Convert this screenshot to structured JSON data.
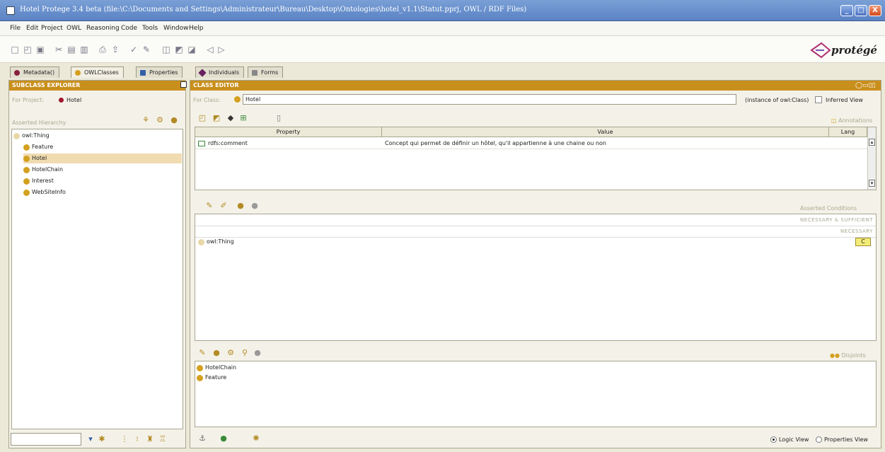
{
  "window": {
    "title": "Hotel Protege 3.4 beta   (file:\\C:\\Documents and Settings\\Administrateur\\Bureau\\Desktop\\Ontologies\\hotel_v1.1\\Statut.pprj, OWL / RDF Files)",
    "buttons": {
      "minimize": "_",
      "maximize": "□",
      "close": "X"
    }
  },
  "menu": [
    "File",
    "Edit",
    "Project",
    "OWL",
    "Reasoning",
    "Code",
    "Tools",
    "Window",
    "Help"
  ],
  "logo": {
    "text": "protégé"
  },
  "tabs": [
    {
      "label": "Metadata()",
      "color": "#8a2040"
    },
    {
      "label": "OWLClasses",
      "color": "#d4a020"
    },
    {
      "label": "Properties",
      "color": "#3560a8"
    },
    {
      "label": "Individuals",
      "color": "#6a2060"
    },
    {
      "label": "Forms",
      "color": "#888888"
    }
  ],
  "left": {
    "header": "SUBCLASS EXPLORER",
    "for_project_label": "For Project:",
    "project_name": "Hotel",
    "hierarchy_label": "Asserted Hierarchy",
    "tree": [
      {
        "label": "owl:Thing",
        "depth": 0
      },
      {
        "label": "Feature",
        "depth": 1
      },
      {
        "label": "Hotel",
        "depth": 1,
        "selected": true
      },
      {
        "label": "HotelChain",
        "depth": 1
      },
      {
        "label": "Interest",
        "depth": 1
      },
      {
        "label": "WebSiteInfo",
        "depth": 1
      }
    ]
  },
  "right": {
    "header": "CLASS EDITOR",
    "for_class_label": "For Class:",
    "class_name": "Hotel",
    "instance_of": "(instance of owl:Class)",
    "inferred_view": "Inferred View",
    "annotations_label": "Annotations",
    "annotation_columns": [
      "Property",
      "Value",
      "Lang"
    ],
    "annotation_rows": [
      {
        "property": "rdfs:comment",
        "value": "Concept qui permet de définir un hôtel, qu'il appartienne à une chaine ou non",
        "lang": ""
      }
    ],
    "asserted_conditions_label": "Asserted Conditions",
    "necessary_sufficient_label": "NECESSARY & SUFFICIENT",
    "necessary_label": "NECESSARY",
    "conditions": [
      "owl:Thing"
    ],
    "condition_badge": "C",
    "disjoints_label": "Disjoints",
    "disjoints": [
      "HotelChain",
      "Feature"
    ],
    "logic_view": "Logic View",
    "properties_view": "Properties View"
  }
}
